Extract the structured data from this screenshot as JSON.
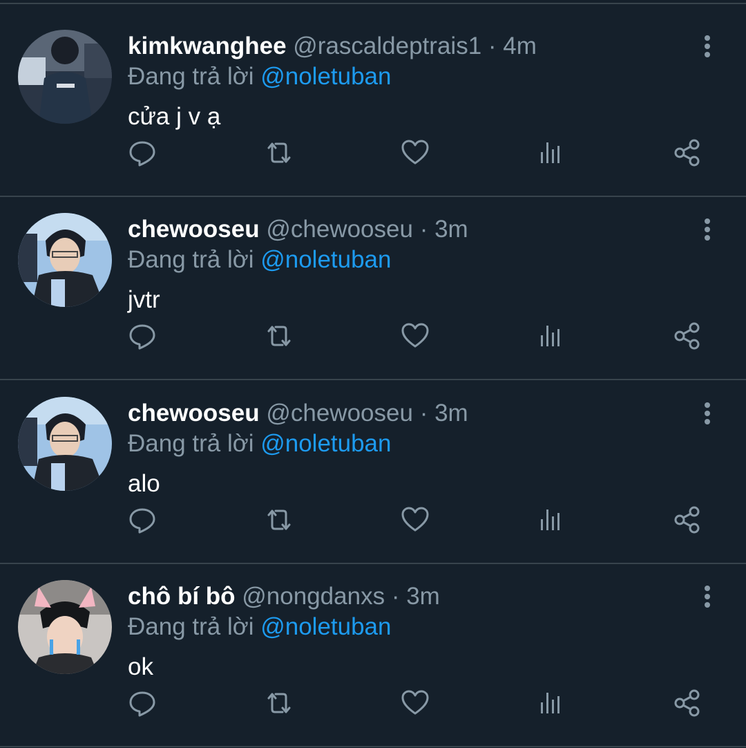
{
  "colors": {
    "background": "#15202b",
    "divider": "#38444d",
    "name": "#ffffff",
    "secondary": "#8899a6",
    "mention": "#1d9bf0"
  },
  "tweets": [
    {
      "name": "kimkwanghee",
      "handle": "@rascaldeptrais1",
      "dot": "·",
      "time": "4m",
      "reply_prefix": "Đang trả lời",
      "reply_to": "@noletuban",
      "text": "cửa j v ạ",
      "avatar_icon": "avatar-photo"
    },
    {
      "name": "chewooseu",
      "handle": "@chewooseu",
      "dot": "·",
      "time": "3m",
      "reply_prefix": "Đang trả lời",
      "reply_to": "@noletuban",
      "text": "jvtr",
      "avatar_icon": "avatar-photo"
    },
    {
      "name": "chewooseu",
      "handle": "@chewooseu",
      "dot": "·",
      "time": "3m",
      "reply_prefix": "Đang trả lời",
      "reply_to": "@noletuban",
      "text": "alo",
      "avatar_icon": "avatar-photo"
    },
    {
      "name": "chô bí bô",
      "handle": "@nongdanxs",
      "dot": "·",
      "time": "3m",
      "reply_prefix": "Đang trả lời",
      "reply_to": "@noletuban",
      "text": "ok",
      "avatar_icon": "avatar-photo"
    }
  ],
  "action_icons": [
    "reply-icon",
    "retweet-icon",
    "like-icon",
    "analytics-icon",
    "share-icon"
  ],
  "more_icon": "more-vertical-icon"
}
